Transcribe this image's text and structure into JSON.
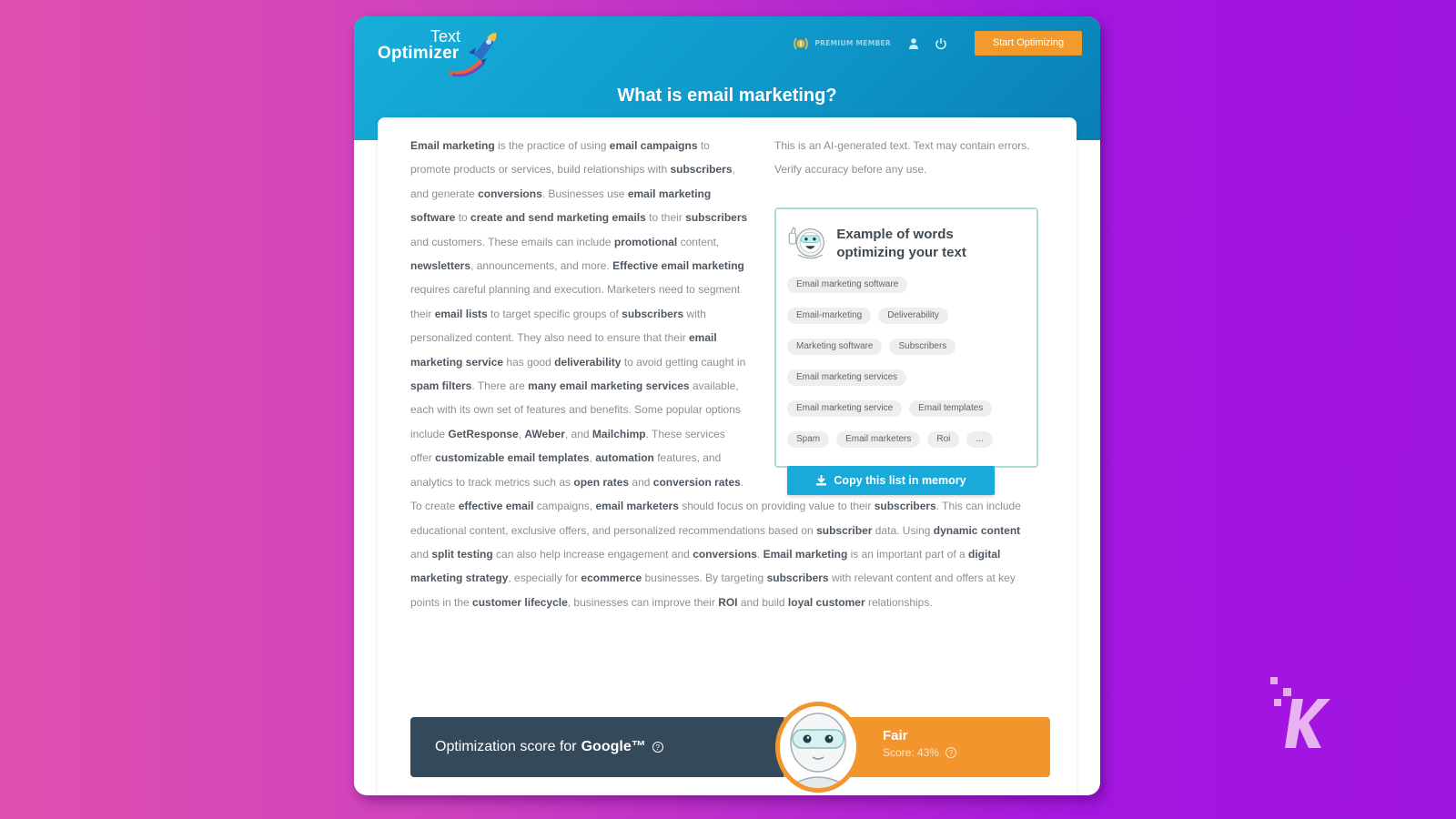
{
  "app": {
    "logo_line1": "Text",
    "logo_line2": "Optimizer",
    "logo_icon": "rocket-icon"
  },
  "topnav": {
    "premium_label": "PREMIUM MEMBER",
    "premium_icon": "laurel-medal-icon",
    "user_icon": "user-icon",
    "power_icon": "power-icon",
    "start_button": "Start Optimizing"
  },
  "page": {
    "title": "What is email marketing?"
  },
  "article": {
    "paragraph": [
      {
        "b": "Email marketing"
      },
      " is the practice of using ",
      {
        "b": "email campaigns"
      },
      " to promote products or services, build relationships with ",
      {
        "b": "subscribers"
      },
      ", and generate ",
      {
        "b": "conversions"
      },
      ". Businesses use ",
      {
        "b": "email marketing software"
      },
      " to ",
      {
        "b": "create and send marketing emails"
      },
      " to their ",
      {
        "b": "subscribers"
      },
      " and customers. These emails can include ",
      {
        "b": "promotional"
      },
      " content, ",
      {
        "b": "newsletters"
      },
      ", announcements, and more. ",
      {
        "b": "Effective email marketing"
      },
      " requires careful planning and execution. Marketers need to segment their ",
      {
        "b": "email lists"
      },
      " to target specific groups of ",
      {
        "b": "subscribers"
      },
      " with personalized content. They also need to ensure that their ",
      {
        "b": "email marketing service"
      },
      " has good ",
      {
        "b": "deliverability"
      },
      " to avoid getting caught in ",
      {
        "b": "spam filters"
      },
      ". There are ",
      {
        "b": "many email marketing services"
      },
      " available, each with its own set of features and benefits. Some popular options include ",
      {
        "b": "GetResponse"
      },
      ", ",
      {
        "b": "AWeber"
      },
      ", and ",
      {
        "b": "Mailchimp"
      },
      ". These services offer ",
      {
        "b": "customizable email templates"
      },
      ", ",
      {
        "b": "automation"
      },
      " features, and analytics to track metrics such as ",
      {
        "b": "open rates"
      },
      " and ",
      {
        "b": "conversion rates"
      },
      ". To create ",
      {
        "b": "effective email"
      },
      " campaigns, ",
      {
        "b": "email marketers"
      },
      " should focus on providing value to their ",
      {
        "b": "subscribers"
      },
      ". This can include educational content, exclusive offers, and personalized recommendations based on ",
      {
        "b": "subscriber"
      },
      " data. Using ",
      {
        "b": "dynamic content"
      },
      " and ",
      {
        "b": "split testing"
      },
      " can also help increase engagement and ",
      {
        "b": "conversions"
      },
      ". ",
      {
        "b": "Email marketing"
      },
      " is an important part of a ",
      {
        "b": "digital marketing strategy"
      },
      ", especially for ",
      {
        "b": "ecommerce"
      },
      " businesses. By targeting ",
      {
        "b": "subscribers"
      },
      " with relevant content and offers at key points in the ",
      {
        "b": "customer lifecycle"
      },
      ", businesses can improve their ",
      {
        "b": "ROI"
      },
      " and build ",
      {
        "b": "loyal customer"
      },
      " relationships."
    ]
  },
  "sidebar": {
    "disclaimer": "This is an AI-generated text. Text may contain errors. Verify accuracy before any use.",
    "card_title": "Example of words optimizing your text",
    "card_icon": "robot-thumbs-up-icon",
    "keyword_rows": [
      [
        "Email marketing software"
      ],
      [
        "Email-marketing",
        "Deliverability"
      ],
      [
        "Marketing software",
        "Subscribers"
      ],
      [
        "Email marketing services"
      ],
      [
        "Email marketing service",
        "Email templates"
      ],
      [
        "Spam",
        "Email marketers",
        "Roi",
        "..."
      ]
    ],
    "copy_button": "Copy this list in memory",
    "copy_icon": "download-icon"
  },
  "score": {
    "label_prefix": "Optimization score for",
    "label_brand": "Google™",
    "help_icon": "help-icon",
    "rating": "Fair",
    "score_text": "Score: 43%",
    "score_percent": 43,
    "avatar_icon": "robot-avatar-icon"
  },
  "colors": {
    "header_blue": "#17aed8",
    "accent_orange": "#f39a2e",
    "score_dark": "#34495a",
    "copy_button_blue": "#1aaad9",
    "card_border": "#a9dcd5"
  },
  "watermark": {
    "letter": "K",
    "icon": "knowtechie-k-logo-icon"
  }
}
